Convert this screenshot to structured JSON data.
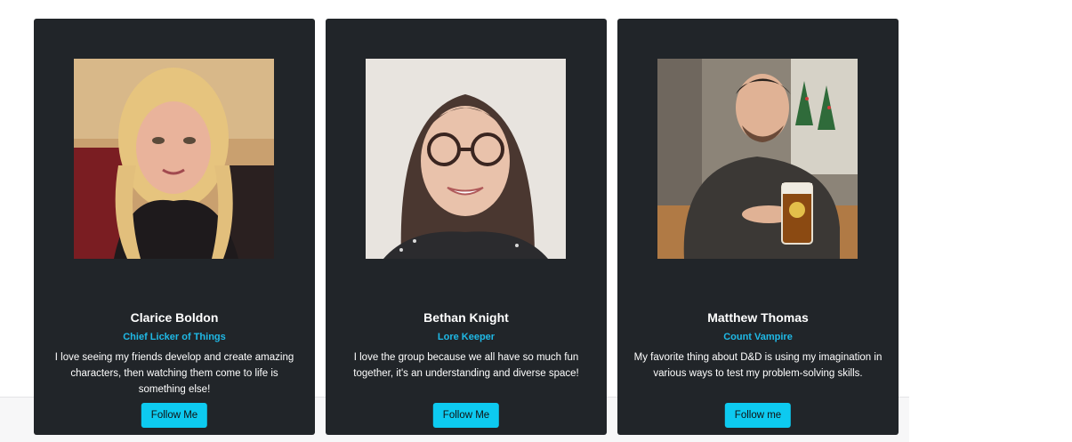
{
  "members": [
    {
      "name": "Clarice Boldon",
      "role": "Chief Licker of Things",
      "bio": "I love seeing my friends develop and create amazing characters, then watching them come to life is something else!",
      "button_label": "Follow Me"
    },
    {
      "name": "Bethan Knight",
      "role": "Lore Keeper",
      "bio": "I love the group because we all have so much fun together, it's an understanding and diverse space!",
      "button_label": "Follow Me"
    },
    {
      "name": "Matthew Thomas",
      "role": "Count Vampire",
      "bio": "My favorite thing about D&D is using my imagination in various ways to test my problem-solving skills.",
      "button_label": "Follow me"
    }
  ],
  "colors": {
    "card_background": "#212529",
    "role_text": "#1fb9e6",
    "button_background": "#0dcaf0"
  }
}
